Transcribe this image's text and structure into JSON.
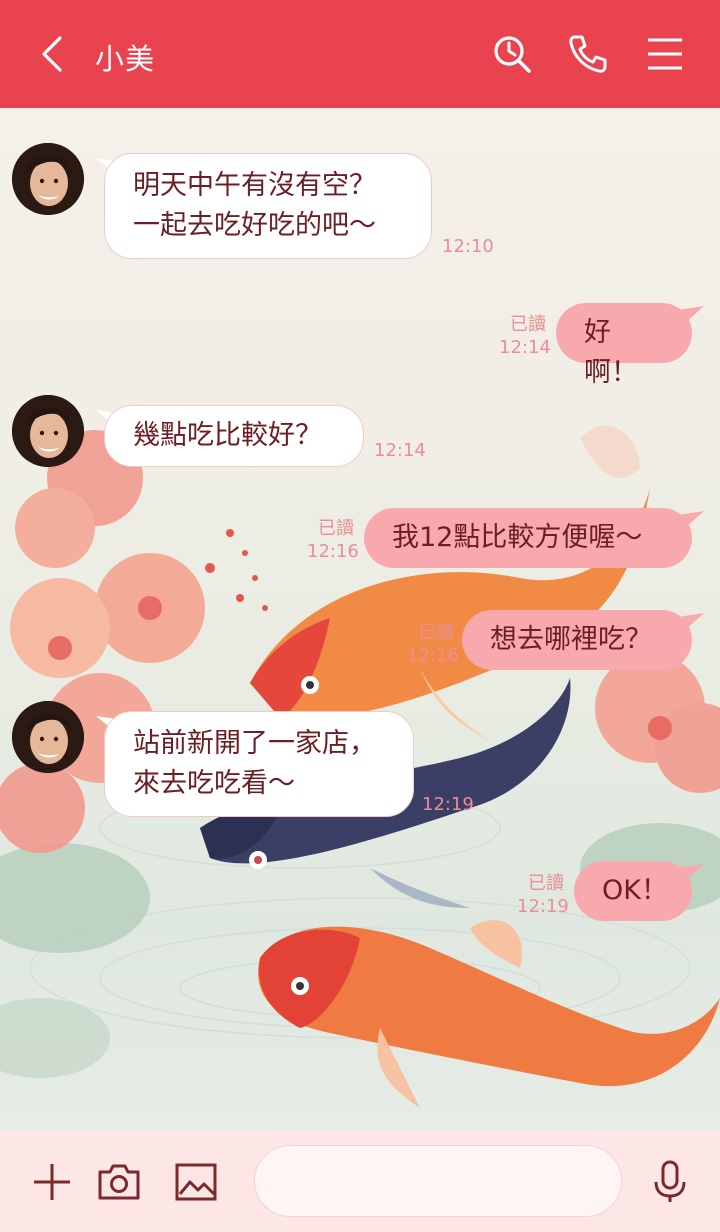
{
  "header": {
    "title": "小美",
    "back_icon": "chevron-left-icon",
    "search_icon": "search-icon",
    "call_icon": "phone-icon",
    "menu_icon": "menu-icon",
    "bg_color": "#e8434e"
  },
  "messages": [
    {
      "side": "in",
      "text": "明天中午有沒有空？\n一起去吃好吃的吧～",
      "time": "12:10"
    },
    {
      "side": "out",
      "text": "好啊！",
      "read": "已讀",
      "time": "12:14"
    },
    {
      "side": "in",
      "text": "幾點吃比較好？",
      "time": "12:14"
    },
    {
      "side": "out",
      "text": "我12點比較方便喔～",
      "read": "已讀",
      "time": "12:16"
    },
    {
      "side": "out",
      "text": "想去哪裡吃？",
      "read": "已讀",
      "time": "12:16"
    },
    {
      "side": "in",
      "text": "站前新開了一家店，\n來去吃吃看～",
      "time": "12:19"
    },
    {
      "side": "out",
      "text": "OK！",
      "read": "已讀",
      "time": "12:19"
    }
  ],
  "input": {
    "placeholder": "",
    "icons": [
      "plus-icon",
      "camera-icon",
      "image-icon",
      "emoji-icon",
      "microphone-icon"
    ]
  },
  "colors": {
    "outgoing_bubble": "#f7a9ad",
    "incoming_bubble": "#ffffff",
    "text": "#6b1f22",
    "meta": "#ea8e94"
  }
}
